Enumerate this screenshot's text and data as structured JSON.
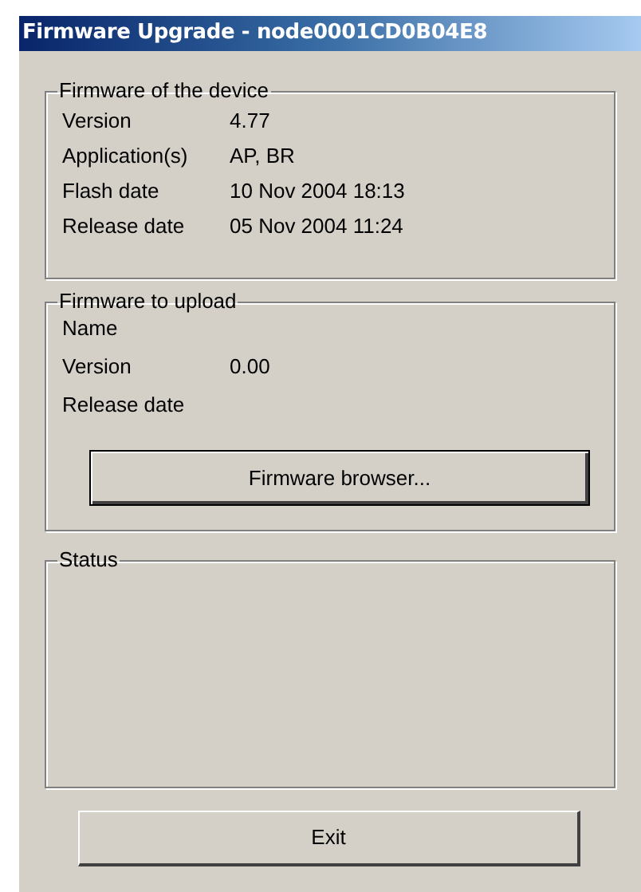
{
  "window": {
    "title": "Firmware Upgrade - node0001CD0B04E8"
  },
  "device_firmware": {
    "title": "Firmware of the device",
    "rows": [
      {
        "label": "Version",
        "value": "4.77"
      },
      {
        "label": "Application(s)",
        "value": "AP, BR"
      },
      {
        "label": "Flash date",
        "value": "10 Nov 2004 18:13"
      },
      {
        "label": "Release date",
        "value": "05 Nov 2004 11:24"
      }
    ]
  },
  "upload_firmware": {
    "title": "Firmware to upload",
    "rows": [
      {
        "label": "Name"
      },
      {
        "label": "Version",
        "value": "0.00"
      },
      {
        "label": "Release date"
      }
    ],
    "button": {
      "label": "Firmware browser...",
      "default": true
    }
  },
  "status": {
    "title": "Status"
  },
  "exit_button": {
    "label": "Exit",
    "default": false
  }
}
